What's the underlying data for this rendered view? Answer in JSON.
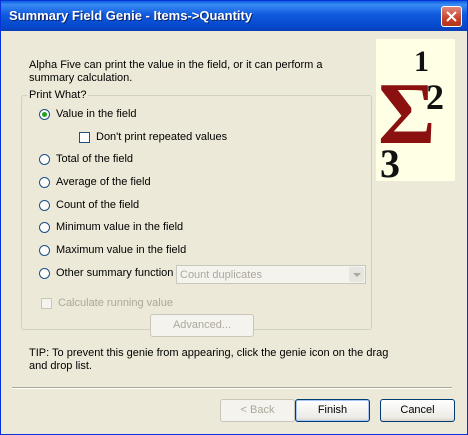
{
  "window": {
    "title": "Summary Field Genie - Items->Quantity"
  },
  "description": "Alpha Five can print the value in the field, or it can perform a summary calculation.",
  "group": {
    "legend": "Print What?",
    "options": [
      {
        "label": "Value in the field",
        "selected": true
      },
      {
        "label": "Total of the field",
        "selected": false
      },
      {
        "label": "Average of the field",
        "selected": false
      },
      {
        "label": "Count of the field",
        "selected": false
      },
      {
        "label": "Minimum value in the field",
        "selected": false
      },
      {
        "label": "Maximum value in the field",
        "selected": false
      },
      {
        "label": "Other summary function",
        "selected": false
      }
    ],
    "dont_print_repeated": {
      "label": "Don't print repeated values",
      "checked": false
    },
    "summary_function_select": {
      "value": "Count duplicates",
      "enabled": false
    },
    "running_value": {
      "label": "Calculate running value",
      "checked": false,
      "enabled": false
    }
  },
  "advanced_button": "Advanced...",
  "tip": "TIP: To prevent this genie from appearing, click the genie icon on the drag and drop list.",
  "buttons": {
    "back": "< Back",
    "finish": "Finish",
    "cancel": "Cancel"
  },
  "logo": {
    "symbol": "Σ",
    "digit1": "1",
    "digit2": "2",
    "digit3": "3"
  }
}
